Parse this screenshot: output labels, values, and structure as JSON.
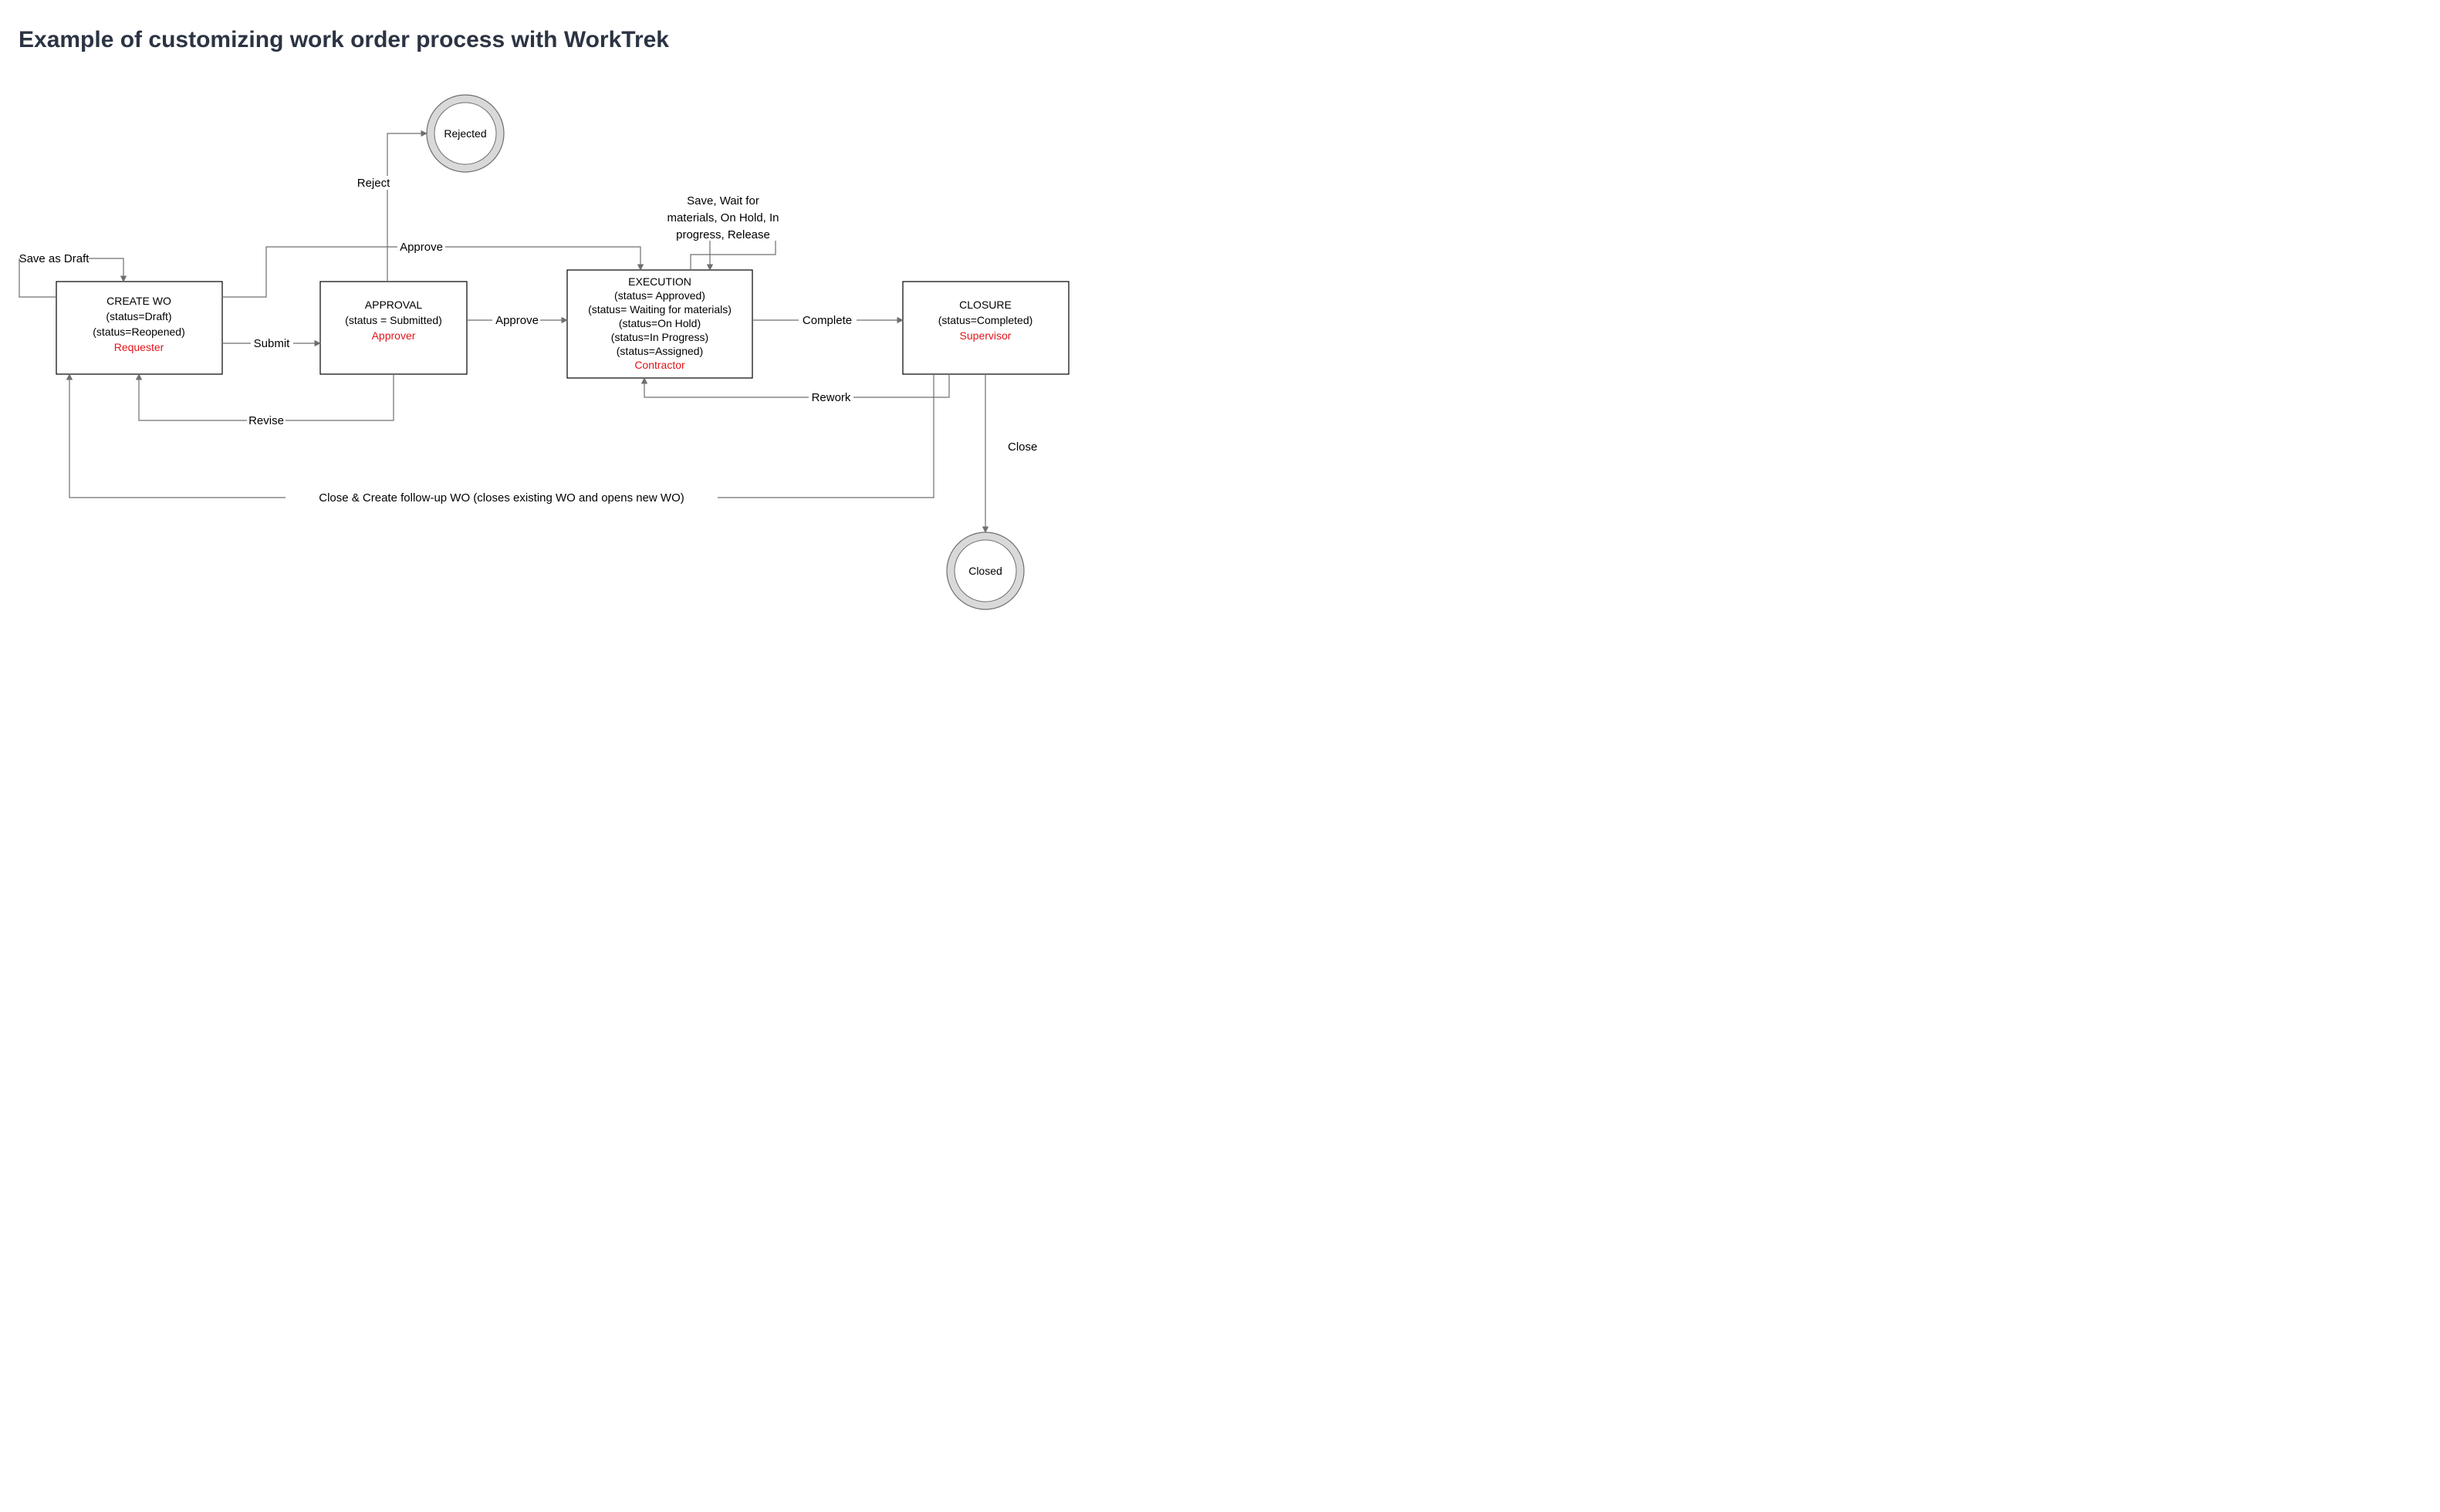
{
  "title": "Example of customizing work order process with WorkTrek",
  "terminals": {
    "rejected": "Rejected",
    "closed": "Closed"
  },
  "nodes": {
    "create": {
      "title": "CREATE WO",
      "lines": [
        "(status=Draft)",
        "(status=Reopened)"
      ],
      "role": "Requester"
    },
    "approval": {
      "title": "APPROVAL",
      "lines": [
        "(status = Submitted)"
      ],
      "role": "Approver"
    },
    "execution": {
      "title": "EXECUTION",
      "lines": [
        "(status= Approved)",
        "(status= Waiting for materials)",
        "(status=On Hold)",
        "(status=In Progress)",
        "(status=Assigned)"
      ],
      "role": "Contractor"
    },
    "closure": {
      "title": "CLOSURE",
      "lines": [
        "(status=Completed)"
      ],
      "role": "Supervisor"
    }
  },
  "edges": {
    "save_as_draft": "Save as Draft",
    "submit": "Submit",
    "reject": "Reject",
    "approve_top": "Approve",
    "approve_mid": "Approve",
    "revise": "Revise",
    "exec_self": {
      "l1": "Save, Wait for",
      "l2": "materials, On Hold, In",
      "l3": "progress, Release"
    },
    "complete": "Complete",
    "rework": "Rework",
    "close": "Close",
    "close_followup": "Close & Create follow-up WO (closes existing WO and opens new WO)"
  }
}
